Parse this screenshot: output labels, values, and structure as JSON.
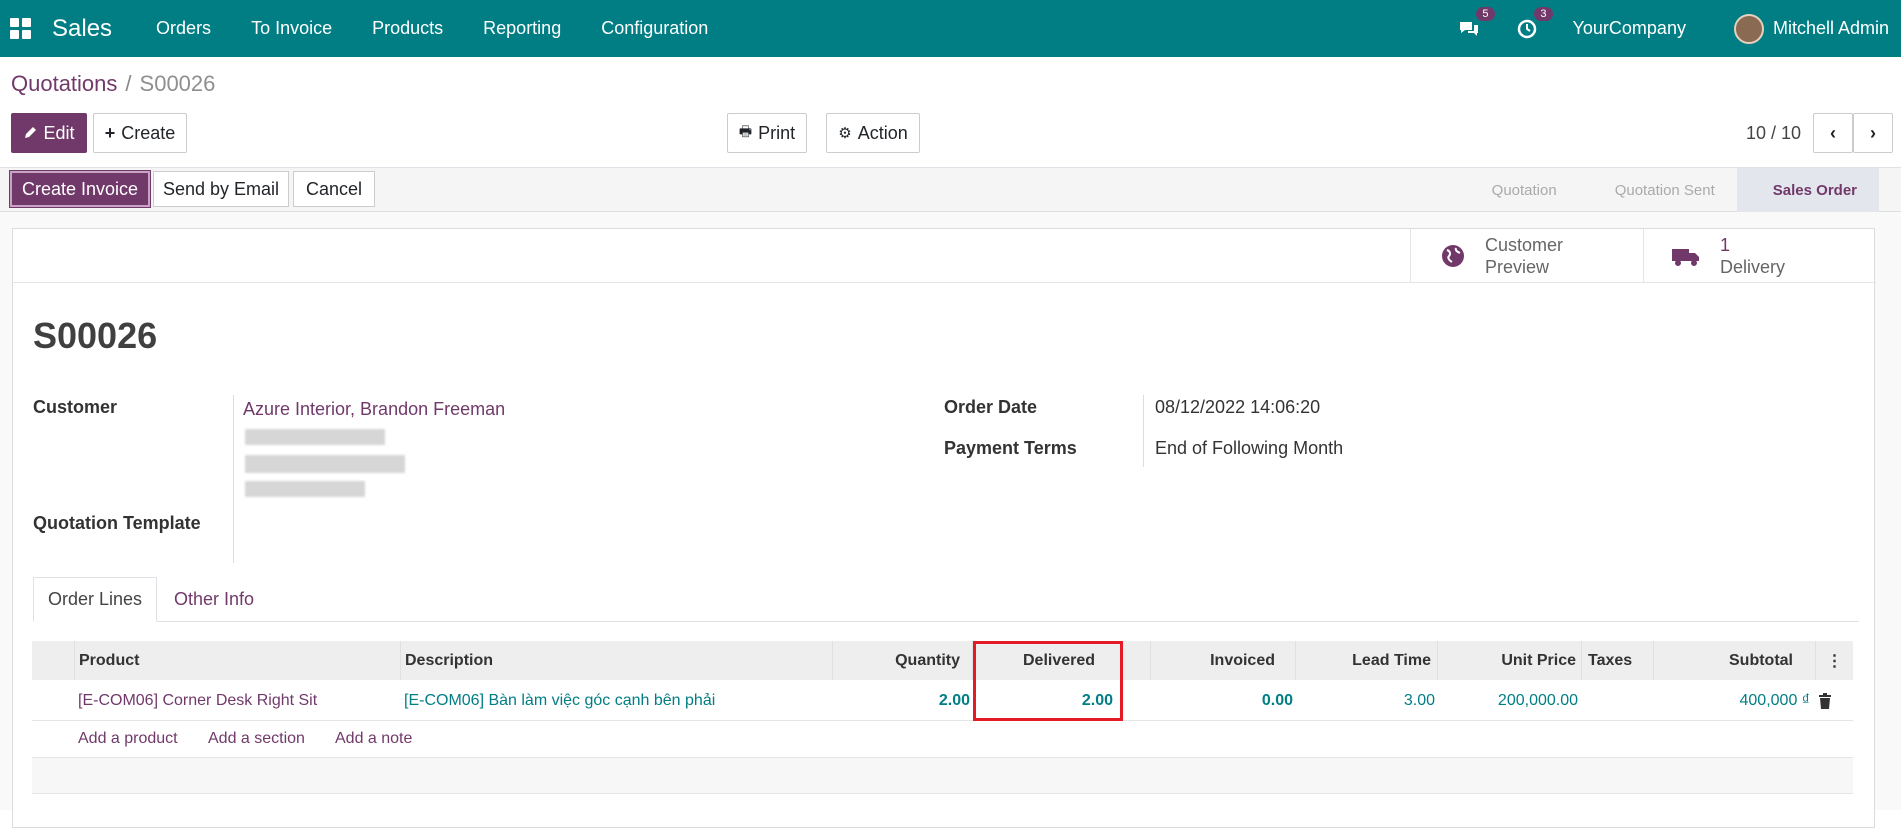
{
  "nav": {
    "app": "Sales",
    "menu": [
      "Orders",
      "To Invoice",
      "Products",
      "Reporting",
      "Configuration"
    ],
    "messages_count": "5",
    "activities_count": "3",
    "company": "YourCompany",
    "user": "Mitchell Admin"
  },
  "breadcrumb": {
    "parent": "Quotations",
    "sep": "/",
    "current": "S00026"
  },
  "toolbar": {
    "edit": "Edit",
    "create": "Create",
    "print": "Print",
    "action": "Action",
    "pager": "10 / 10"
  },
  "status": {
    "create_invoice": "Create Invoice",
    "send_email": "Send by Email",
    "cancel": "Cancel",
    "stages": [
      "Quotation",
      "Quotation Sent",
      "Sales Order"
    ],
    "active_stage": "Sales Order"
  },
  "smart": {
    "preview_line1": "Customer",
    "preview_line2": "Preview",
    "delivery_count": "1",
    "delivery_label": "Delivery"
  },
  "record": {
    "name": "S00026",
    "customer_label": "Customer",
    "customer": "Azure Interior, Brandon Freeman",
    "template_label": "Quotation Template",
    "order_date_label": "Order Date",
    "order_date": "08/12/2022 14:06:20",
    "terms_label": "Payment Terms",
    "terms": "End of Following Month"
  },
  "tabs": [
    "Order Lines",
    "Other Info"
  ],
  "lines": {
    "headers": [
      "Product",
      "Description",
      "Quantity",
      "Delivered",
      "Invoiced",
      "Lead Time",
      "Unit Price",
      "Taxes",
      "Subtotal"
    ],
    "rows": [
      {
        "product": "[E-COM06] Corner Desk Right Sit",
        "description": "[E-COM06] Bàn làm việc góc cạnh bên phải",
        "quantity": "2.00",
        "delivered": "2.00",
        "invoiced": "0.00",
        "lead_time": "3.00",
        "unit_price": "200,000.00",
        "taxes": "",
        "subtotal": "400,000 ₫"
      }
    ],
    "add_product": "Add a product",
    "add_section": "Add a section",
    "add_note": "Add a note"
  }
}
